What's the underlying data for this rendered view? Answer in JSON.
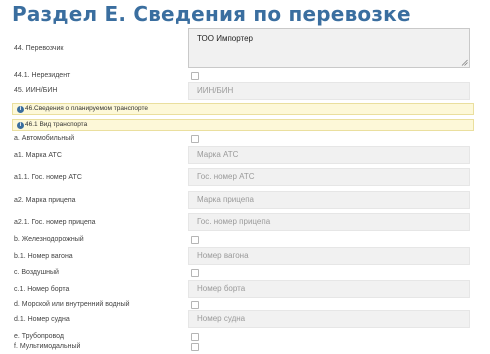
{
  "section": {
    "title": "Раздел Е. Сведения по перевозке"
  },
  "carrier": {
    "label": "44. Перевозчик",
    "value": "ТОО Импортер"
  },
  "nonresident": {
    "label": "44.1. Нерезидент"
  },
  "iin": {
    "label": "45. ИИН/БИН",
    "placeholder": "ИИН/БИН"
  },
  "info_planned": {
    "icon": "info-icon",
    "text": "46.Сведения о планируемом транспорте"
  },
  "info_type": {
    "icon": "info-icon",
    "text": "46.1 Вид транспорта"
  },
  "auto": {
    "label": "а. Автомобильный"
  },
  "vehicle_brand": {
    "label": "а1. Марка АТС",
    "placeholder": "Марка АТС"
  },
  "vehicle_number": {
    "label": "а1.1. Гос. номер АТС",
    "placeholder": "Гос. номер АТС"
  },
  "trailer_brand": {
    "label": "а2. Марка прицепа",
    "placeholder": "Марка прицепа"
  },
  "trailer_number": {
    "label": "а2.1. Гос. номер прицепа",
    "placeholder": "Гос. номер прицепа"
  },
  "rail": {
    "label": "b. Железнодорожный"
  },
  "wagon_number": {
    "label": "b.1. Номер вагона",
    "placeholder": "Номер вагона"
  },
  "air": {
    "label": "c. Воздушный"
  },
  "flight_number": {
    "label": "c.1. Номер борта",
    "placeholder": "Номер борта"
  },
  "water": {
    "label": "d. Морской или внутренний водный"
  },
  "vessel_number": {
    "label": "d.1. Номер судна",
    "placeholder": "Номер судна"
  },
  "pipeline": {
    "label": "e. Трубопровод"
  },
  "multimodal": {
    "label": "f. Мультимодальный"
  }
}
